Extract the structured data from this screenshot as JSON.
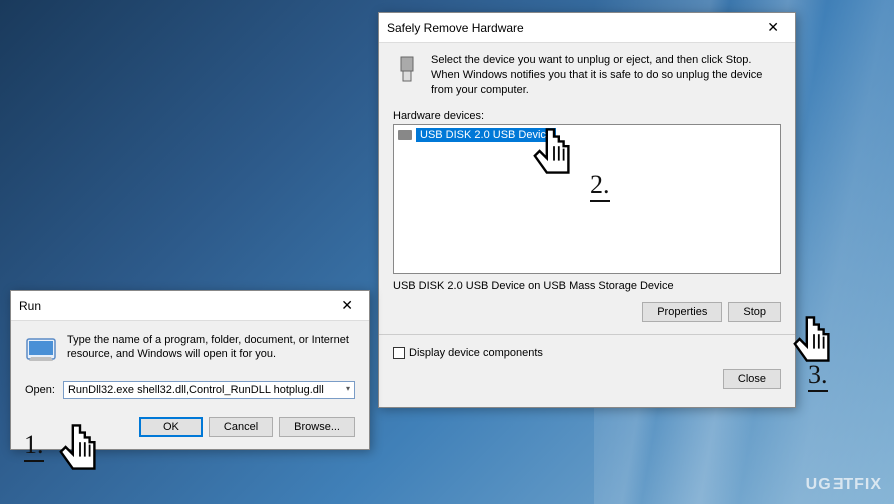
{
  "run": {
    "title": "Run",
    "desc": "Type the name of a program, folder, document, or Internet resource, and Windows will open it for you.",
    "open_label": "Open:",
    "input_value": "RunDll32.exe shell32.dll,Control_RunDLL hotplug.dll",
    "ok_label": "OK",
    "cancel_label": "Cancel",
    "browse_label": "Browse..."
  },
  "srh": {
    "title": "Safely Remove Hardware",
    "desc": "Select the device you want to unplug or eject, and then click Stop. When Windows notifies you that it is safe to do so unplug the device from your computer.",
    "list_label": "Hardware devices:",
    "items": [
      {
        "label": "USB DISK 2.0 USB Device"
      }
    ],
    "status_text": "USB DISK 2.0 USB Device on USB Mass Storage Device",
    "properties_label": "Properties",
    "stop_label": "Stop",
    "checkbox_label": "Display device components",
    "close_label": "Close"
  },
  "steps": {
    "s1": "1.",
    "s2": "2.",
    "s3": "3."
  },
  "watermark": "UGETFIX"
}
